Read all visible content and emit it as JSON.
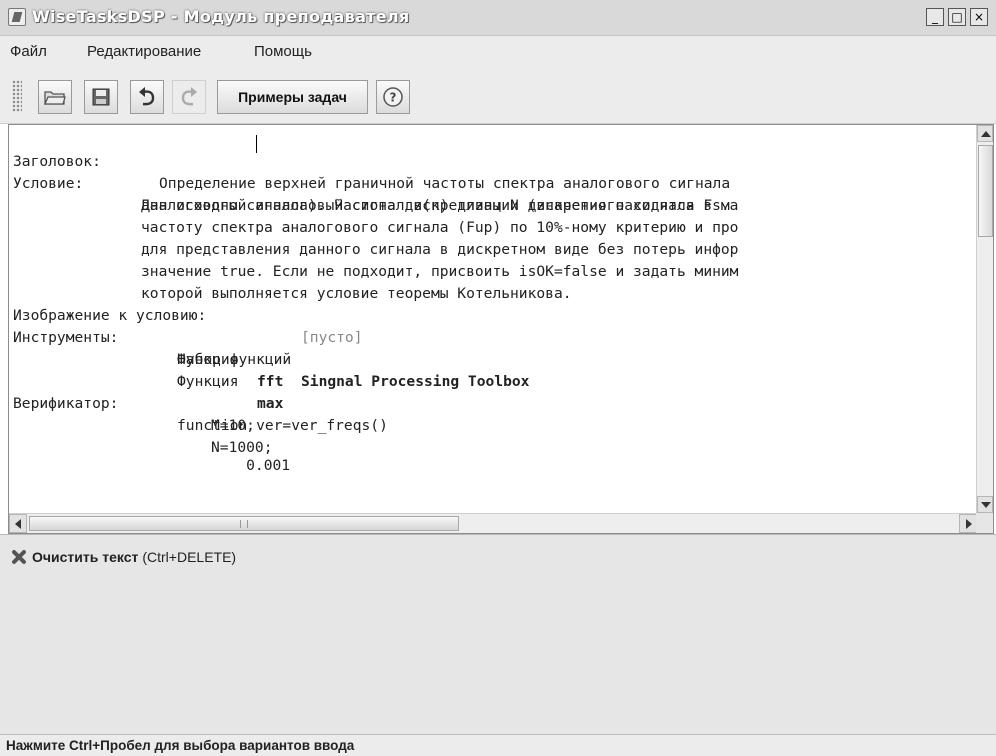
{
  "window": {
    "title": "WiseTasksDSP - Модуль преподавателя",
    "controls": {
      "minimize": "_",
      "maximize": "□",
      "close": "×"
    }
  },
  "menu": {
    "items": [
      "Файл",
      "Редактирование",
      "Помощь"
    ]
  },
  "toolbar": {
    "buttons": [
      {
        "icon": "open-folder-icon",
        "enabled": true
      },
      {
        "icon": "save-disk-icon",
        "enabled": true
      },
      {
        "icon": "undo-icon",
        "enabled": true
      },
      {
        "icon": "redo-icon",
        "enabled": false
      }
    ],
    "examples_label": "Примеры задач",
    "help_icon": "help-icon"
  },
  "editor": {
    "title_key": "Заголовок:",
    "title_value": "Определение верхней граничной частоты спектра аналогового сигнала",
    "condition_key": "Условие:",
    "condition_lines": [
      "Дан исходный аналоговый сигнал s(n) длины N (значения находятся в ма",
      "аналогового сигнала). Частота дискретизации дискретного сигнала Fs.",
      "частоту спектра аналогового сигнала (Fup) по 10%-ному критерию и про",
      "для представления данного сигнала в дискретном виде без потерь инфор",
      "значение true. Если не подходит, присвоить isOK=false и задать миним",
      "которой выполняется условие теоремы Котельникова."
    ],
    "image_key": "Изображение к условию:",
    "image_value": "[пусто]",
    "tools_key": "Инструменты:",
    "tools": [
      {
        "prefix": "Набор функций",
        "name": "Singnal Processing Toolbox"
      },
      {
        "prefix": "Функция",
        "name": "fft"
      },
      {
        "prefix": "Функция",
        "name": "max"
      }
    ],
    "verifier_key": "Верификатор:",
    "verifier_lines": [
      "function ver=ver_freqs()",
      "M=10;",
      "N=1000;",
      "    0.001"
    ]
  },
  "lower_panel": {
    "clear_label": "Очистить текст",
    "clear_shortcut": "(Ctrl+DELETE)"
  },
  "status": {
    "text": "Нажмите Ctrl+Пробел для выбора вариантов ввода"
  },
  "colors": {
    "titlebar": "#d9d9d9",
    "panel": "#e6e6e6",
    "editor_bg": "#ffffff"
  }
}
